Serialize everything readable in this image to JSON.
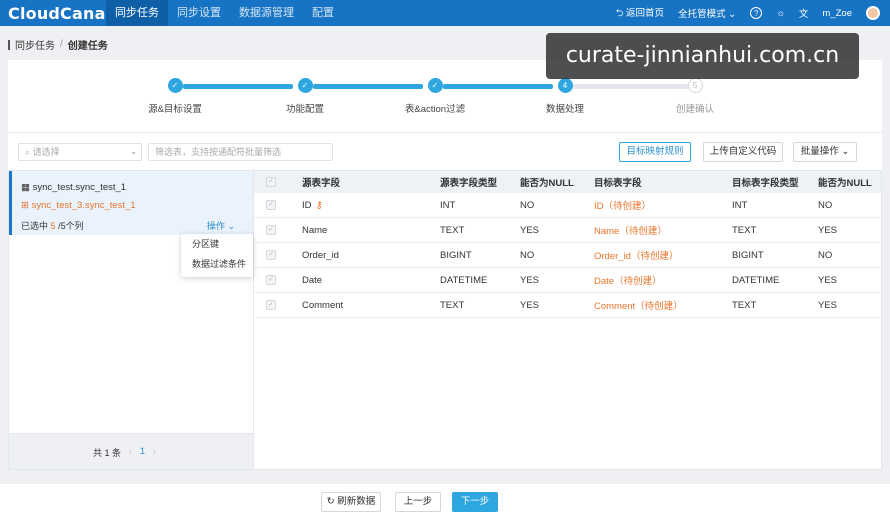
{
  "app": {
    "logo": "CloudCanal",
    "nav": [
      "同步任务",
      "同步设置",
      "数据源管理",
      "配置"
    ],
    "back_home": "返回首页",
    "mode": "全托管模式",
    "user": "m_Zoe"
  },
  "breadcrumb": {
    "parent": "同步任务",
    "sep": "/",
    "current": "创建任务"
  },
  "watermark": "curate-jinnianhui.com.cn",
  "steps": [
    {
      "label": "源&目标设置",
      "state": "done"
    },
    {
      "label": "功能配置",
      "state": "done"
    },
    {
      "label": "表&action过滤",
      "state": "done"
    },
    {
      "label": "数据处理",
      "state": "current",
      "num": "4"
    },
    {
      "label": "创建确认",
      "state": "todo",
      "num": "5"
    }
  ],
  "filters": {
    "select_placeholder": "请选择",
    "search_placeholder": "筛选表，支持按通配符批量筛选",
    "map_rule_btn": "目标映射规则",
    "upload_code_btn": "上传自定义代码",
    "batch_btn": "批量操作"
  },
  "left": {
    "source_table": "sync_test.sync_test_1",
    "target_table": "sync_test_3.sync_test_1",
    "selected_prefix": "已选中",
    "selected_count": "5",
    "selected_suffix": "/5个列",
    "ops_label": "操作",
    "menu": [
      "分区键",
      "数据过滤条件"
    ],
    "total": "共 1 条",
    "page": "1"
  },
  "table": {
    "headers": [
      "源表字段",
      "源表字段类型",
      "能否为NULL",
      "目标表字段",
      "目标表字段类型",
      "能否为NULL"
    ],
    "rows": [
      {
        "src": "ID",
        "src_type": "INT",
        "src_null": "NO",
        "dst": "ID（待创建）",
        "dst_type": "INT",
        "dst_null": "NO"
      },
      {
        "src": "Name",
        "src_type": "TEXT",
        "src_null": "YES",
        "dst": "Name（待创建）",
        "dst_type": "TEXT",
        "dst_null": "YES"
      },
      {
        "src": "Order_id",
        "src_type": "BIGINT",
        "src_null": "NO",
        "dst": "Order_id（待创建）",
        "dst_type": "BIGINT",
        "dst_null": "NO"
      },
      {
        "src": "Date",
        "src_type": "DATETIME",
        "src_null": "YES",
        "dst": "Date（待创建）",
        "dst_type": "DATETIME",
        "dst_null": "YES"
      },
      {
        "src": "Comment",
        "src_type": "TEXT",
        "src_null": "YES",
        "dst": "Comment（待创建）",
        "dst_type": "TEXT",
        "dst_null": "YES"
      }
    ]
  },
  "footer": {
    "refresh": "刷新数据",
    "prev": "上一步",
    "next": "下一步"
  }
}
